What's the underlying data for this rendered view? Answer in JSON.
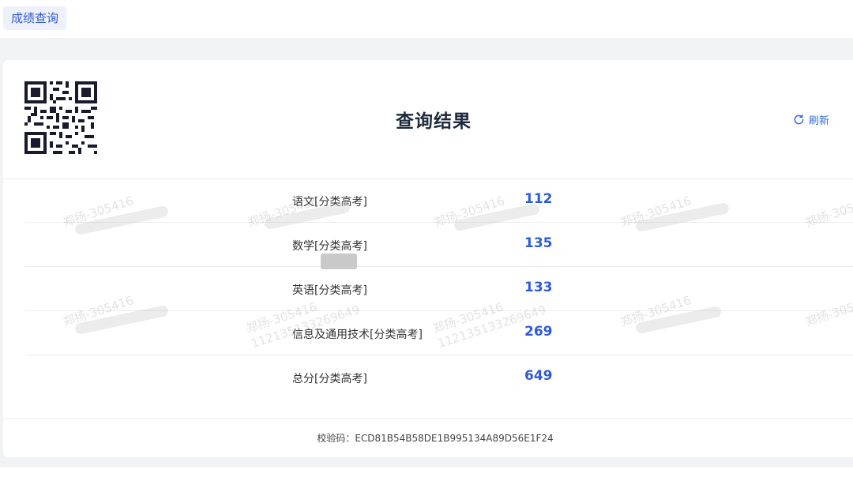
{
  "tab": {
    "label": "成绩查询"
  },
  "card": {
    "title": "查询结果",
    "refresh_label": "刷新",
    "verify_label": "校验码：",
    "verify_code": "ECD81B54B58DE1B995134A89D56E1F24"
  },
  "scores": [
    {
      "subject": "语文[分类高考]",
      "score": "112"
    },
    {
      "subject": "数学[分类高考]",
      "score": "135"
    },
    {
      "subject": "英语[分类高考]",
      "score": "133"
    },
    {
      "subject": "信息及通用技术[分类高考]",
      "score": "269"
    },
    {
      "subject": "总分[分类高考]",
      "score": "649"
    }
  ],
  "watermark": {
    "name": "郑扬-305416",
    "code": "112135133269649"
  },
  "colors": {
    "accent": "#2f5bd6",
    "title": "#1f2a3d",
    "background": "#f2f3f5"
  },
  "icons": [
    "qr-code-icon",
    "refresh-icon"
  ]
}
